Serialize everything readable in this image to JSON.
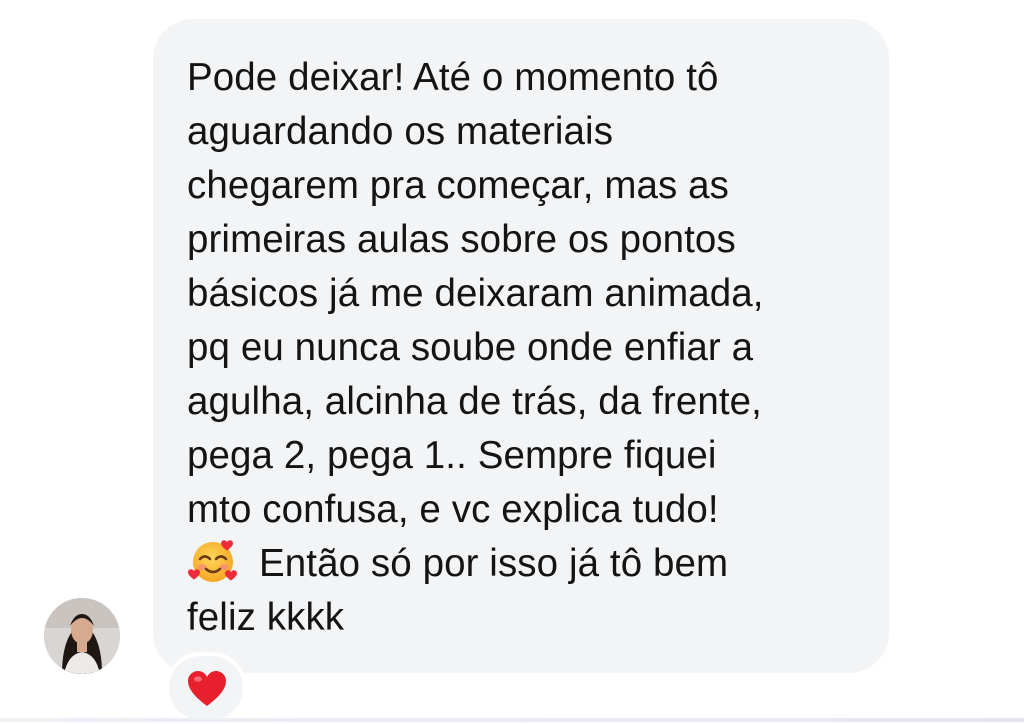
{
  "message": {
    "lines": [
      "Pode deixar! Até o momento tô",
      "aguardando os materiais",
      "chegarem pra começar, mas as",
      "primeiras aulas sobre os pontos",
      "básicos já me deixaram animada,",
      "pq eu nunca soube onde enfiar a",
      "agulha, alcinha de trás, da frente,",
      "pega 2, pega 1.. Sempre fiquei",
      "mto confusa, e vc explica tudo!",
      "Então só por isso já tô bem",
      "feliz kkkk"
    ],
    "emoji": "smiling-face-with-hearts",
    "bubble_color": "#f3f4f6",
    "text_color": "#141414"
  },
  "reaction": {
    "icon": "red-heart",
    "color": "#e8202e"
  },
  "sender": {
    "avatar": "profile-photo"
  }
}
